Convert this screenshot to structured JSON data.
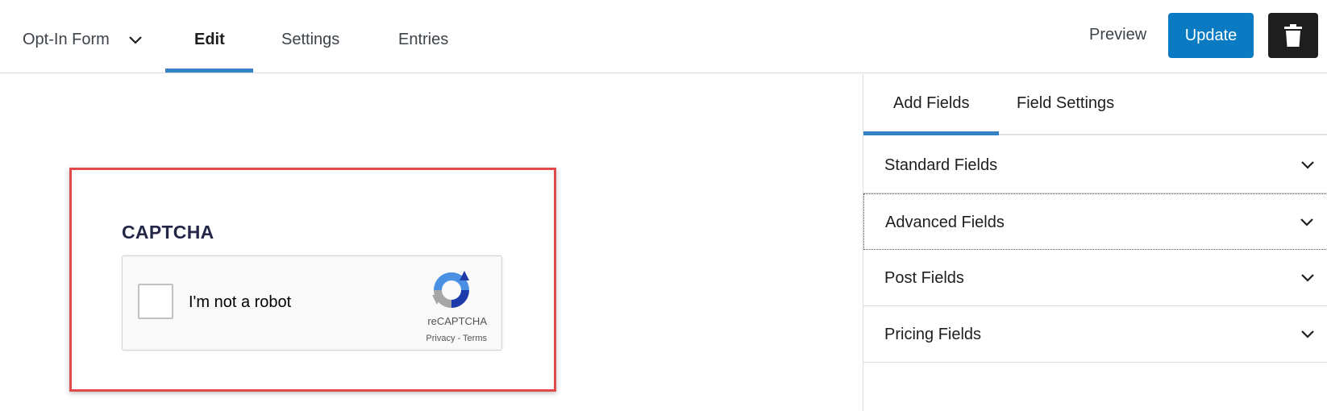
{
  "header": {
    "form_name": "Opt-In Form",
    "tabs": [
      {
        "label": "Edit",
        "active": true
      },
      {
        "label": "Settings",
        "active": false
      },
      {
        "label": "Entries",
        "active": false
      }
    ],
    "preview_label": "Preview",
    "update_label": "Update",
    "trash_icon": "trash-icon"
  },
  "canvas": {
    "field_label": "CAPTCHA",
    "recaptcha": {
      "checkbox_text": "I'm not a robot",
      "brand": "reCAPTCHA",
      "links": "Privacy - Terms"
    }
  },
  "sidebar": {
    "tabs": [
      {
        "label": "Add Fields",
        "active": true
      },
      {
        "label": "Field Settings",
        "active": false
      }
    ],
    "sections": [
      {
        "label": "Standard Fields"
      },
      {
        "label": "Advanced Fields"
      },
      {
        "label": "Post Fields"
      },
      {
        "label": "Pricing Fields"
      }
    ]
  },
  "colors": {
    "accent": "#3582c4",
    "update_button": "#0a7bc2",
    "selected_border": "#e24b4b"
  }
}
